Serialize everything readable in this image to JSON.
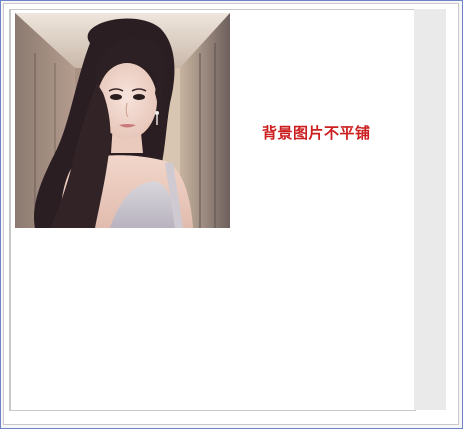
{
  "window": {
    "border_color": "#6f83c9",
    "scrollbar_color": "#eaeaea"
  },
  "content": {
    "caption": "背景图片不平铺",
    "caption_color": "#cc1f1f",
    "image": {
      "alt": "photo",
      "kind": "portrait-photo"
    }
  }
}
